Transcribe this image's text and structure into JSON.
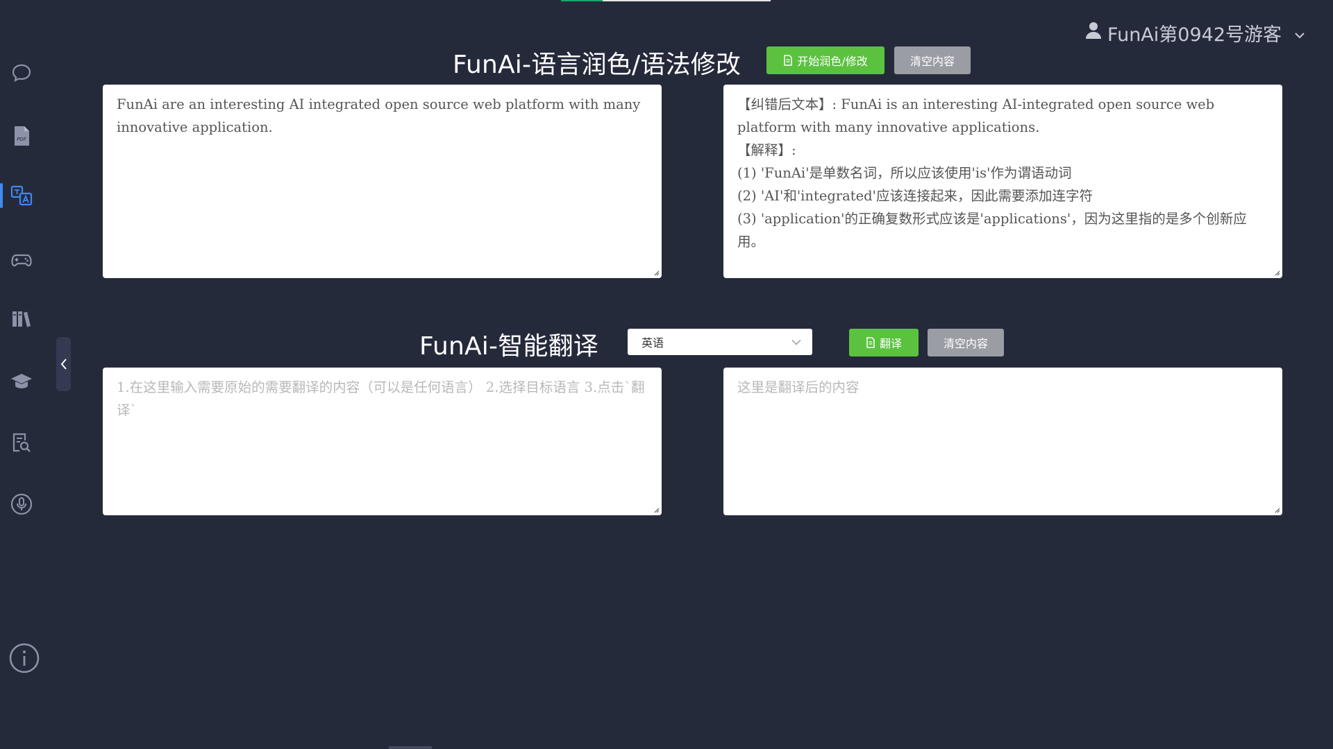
{
  "header": {
    "progress_fraction": 0.2
  },
  "user": {
    "name": "FunAi第0942号游客",
    "icons": {
      "avatar": "user-icon",
      "menu": "chevron-down-icon"
    }
  },
  "sidebar": {
    "items": [
      {
        "name": "chat",
        "icon": "chat-bubble-icon",
        "active": false
      },
      {
        "name": "pdf",
        "icon": "pdf-file-icon",
        "active": false
      },
      {
        "name": "translate",
        "icon": "translate-icon",
        "active": true
      },
      {
        "name": "game",
        "icon": "gamepad-icon",
        "active": false
      },
      {
        "name": "library",
        "icon": "books-icon",
        "active": false
      },
      {
        "name": "education",
        "icon": "graduation-cap-icon",
        "active": false
      },
      {
        "name": "document-search",
        "icon": "document-search-icon",
        "active": false
      },
      {
        "name": "voice",
        "icon": "microphone-icon",
        "active": false
      }
    ],
    "collapse_icon": "chevron-left-icon",
    "info_icon": "info-icon"
  },
  "polish": {
    "title": "FunAi-语言润色/语法修改",
    "start_button": "开始润色/修改",
    "clear_button": "清空内容",
    "input_value": "FunAi are an interesting AI integrated open source web platform with many innovative application.",
    "output_lines": [
      "【纠错后文本】: FunAi is an interesting AI-integrated open source web platform with many innovative applications.",
      "【解释】:",
      "(1) 'FunAi'是单数名词，所以应该使用'is'作为谓语动词",
      "(2) 'AI'和'integrated'应该连接起来，因此需要添加连字符",
      "(3) 'application'的正确复数形式应该是'applications'，因为这里指的是多个创新应用。"
    ]
  },
  "translate": {
    "title": "FunAi-智能翻译",
    "language_selected": "英语",
    "translate_button": "翻译",
    "clear_button": "清空内容",
    "input_placeholder": "1.在这里输入需要原始的需要翻译的内容（可以是任何语言） 2.选择目标语言 3.点击`翻译`",
    "output_placeholder": "这里是翻译后的内容"
  },
  "colors": {
    "background": "#252a3b",
    "accent_blue": "#3d8bf2",
    "button_green": "#5bc240",
    "button_gray": "#9a9da4"
  }
}
